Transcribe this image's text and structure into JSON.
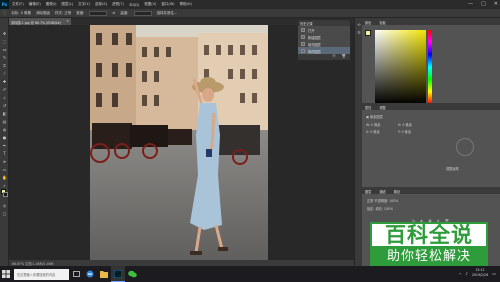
{
  "app": {
    "logo": "Ps",
    "menus": [
      "文件(F)",
      "编辑(E)",
      "图像(I)",
      "图层(L)",
      "文字(Y)",
      "选择(S)",
      "滤镜(T)",
      "3D(D)",
      "视图(V)",
      "窗口(W)",
      "帮助(H)"
    ],
    "window_controls": [
      "—",
      "□",
      "✕"
    ]
  },
  "options_bar": {
    "items": [
      "⬚",
      "羽化: 0 像素",
      "消除锯齿",
      "样式: 正常",
      "宽度:",
      "⇄",
      "高度:",
      "选择并遮住..."
    ]
  },
  "document": {
    "tab_label": "未标题-1.jpg @ 66.7% (RGB/8#)",
    "tab_close": "×",
    "status": "66.67%    文档:1.46M/1.46M"
  },
  "history_popup": {
    "title": "历史记录",
    "items": [
      "打开",
      "新建图层",
      "填充图层",
      "修改图层"
    ],
    "selected_index": 3,
    "footer_icons": [
      "⎘",
      "🗑"
    ]
  },
  "panels": {
    "color_tabs": [
      "颜色",
      "色板"
    ],
    "properties_tabs": [
      "属性",
      "调整"
    ],
    "properties_rows": [
      "▣ 像素图层",
      "W: 0 像素",
      "H: 0 像素",
      "X: 0 像素",
      "Y: 0 像素"
    ],
    "learn_text": "调整画笔",
    "layers_tabs": [
      "图层",
      "通道",
      "路径"
    ],
    "layer_rows": [
      "正常    不透明度: 100%",
      "锁定:    填充: 100%"
    ],
    "layer_buttons": [
      "fx",
      "◐",
      "▣",
      "⊕",
      "🗑"
    ]
  },
  "taskbar": {
    "search_placeholder": "在这里输入你要搜索的内容",
    "time": "15:11",
    "date": "2019/2/26"
  },
  "watermark": {
    "top": "百科全说",
    "bottom": "助你轻松解决"
  },
  "colors": {
    "accent": "#31a8ff",
    "foreground_swatch": "#f5f0a0",
    "watermark_green": "#2f9c3b"
  }
}
